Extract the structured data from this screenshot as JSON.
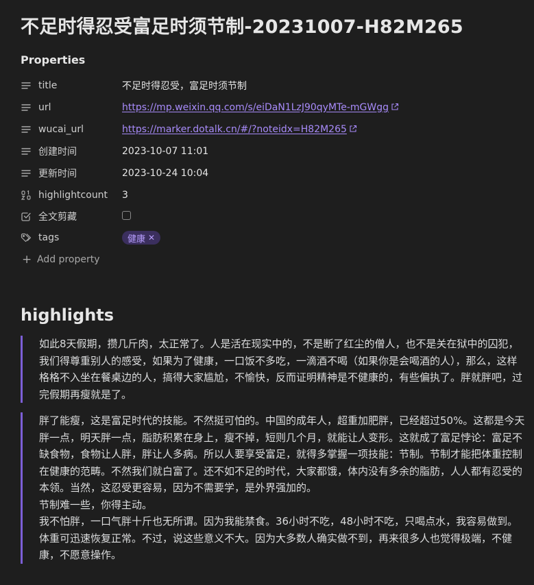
{
  "page": {
    "title": "不足时得忍受富足时须节制-20231007-H82M265"
  },
  "properties": {
    "heading": "Properties",
    "rows": [
      {
        "key": "title",
        "value": "不足时得忍受，富足时须节制",
        "icon": "text-lines-icon"
      },
      {
        "key": "url",
        "value": "https://mp.weixin.qq.com/s/eiDaN1LzJ90qyMTe-mGWgg",
        "icon": "text-lines-icon"
      },
      {
        "key": "wucai_url",
        "value": "https://marker.dotalk.cn/#/?noteidx=H82M265",
        "icon": "text-lines-icon"
      },
      {
        "key": "创建时间",
        "value": "2023-10-07 11:01",
        "icon": "text-lines-icon"
      },
      {
        "key": "更新时间",
        "value": "2023-10-24 10:04",
        "icon": "text-lines-icon"
      },
      {
        "key": "highlightcount",
        "value": "3",
        "icon": "number-icon"
      },
      {
        "key": "全文剪藏",
        "value": "",
        "icon": "checkbox-icon"
      },
      {
        "key": "tags",
        "value": "健康",
        "icon": "tag-icon"
      }
    ],
    "add_label": "Add property"
  },
  "highlights": {
    "heading": "highlights",
    "quotes": [
      {
        "lines": [
          "如此8天假期，攒几斤肉，太正常了。人是活在现实中的，不是断了红尘的僧人，也不是关在狱中的囚犯，我们得尊重别人的感受，如果为了健康，一口饭不多吃，一滴酒不喝（如果你是会喝酒的人），那么，这样格格不入坐在餐桌边的人，搞得大家尴尬，不愉快，反而证明精神是不健康的，有些偏执了。胖就胖吧，过完假期再瘦就是了。"
        ]
      },
      {
        "lines": [
          "胖了能瘦，这是富足时代的技能。不然挺可怕的。中国的成年人，超重加肥胖，已经超过50%。这都是今天胖一点，明天胖一点，脂肪积累在身上，瘦不掉，短则几个月，就能让人变形。这就成了富足悖论：富足不缺食物，食物让人胖，胖让人多病。所以人要享受富足，就得多掌握一项技能：节制。节制才能把体重控制在健康的范畴。不然我们就白富了。还不如不足的时代，大家都饿，体内没有多余的脂肪，人人都有忍受的本领。当然，这忍受更容易，因为不需要学，是外界强加的。",
          "节制难一些，你得主动。",
          "我不怕胖，一口气胖十斤也无所谓。因为我能禁食。36小时不吃，48小时不吃，只喝点水，我容易做到。体重可迅速恢复正常。不过，说这些意义不大。因为大多数人确实做不到，再来很多人也觉得极端，不健康，不愿意操作。"
        ]
      }
    ]
  },
  "colors": {
    "background": "#1e1e1e",
    "accent": "#a88bfa",
    "quote_border": "#7c5fd6",
    "tag_bg": "#3b2f5e"
  }
}
